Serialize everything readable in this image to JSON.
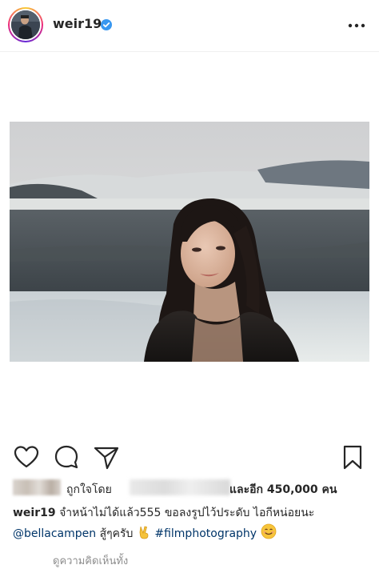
{
  "post": {
    "username": "weir19",
    "more_label": "More options"
  },
  "likes": {
    "prefix": "ถูกใจโดย",
    "others": "และอีก 450,000 คน"
  },
  "caption": {
    "username": "weir19",
    "text_1": "จำหน้าไม่ได้แล้ว555 ขอลงรูปไว้ประดับ ไอกีหน่อยนะ",
    "mention": "@bellacampen",
    "text_2": "สู้ๆครับ",
    "hashtag": "#filmphotography"
  },
  "comments": {
    "link_partial": "ดูความคิดเห็นทั้ง"
  },
  "icons": [
    "verified-icon",
    "more-icon",
    "heart-icon",
    "comment-icon",
    "share-icon",
    "save-icon",
    "victory-hand-icon",
    "smile-icon"
  ],
  "colors": {
    "verified": "#3897f0",
    "link": "#003569",
    "text": "#262626",
    "secondary": "#8e8e8e"
  }
}
